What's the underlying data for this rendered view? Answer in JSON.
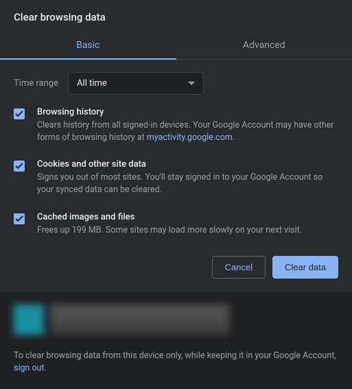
{
  "dialog": {
    "title": "Clear browsing data"
  },
  "tabs": {
    "basic": "Basic",
    "advanced": "Advanced"
  },
  "timeRange": {
    "label": "Time range",
    "value": "All time"
  },
  "options": {
    "history": {
      "title": "Browsing history",
      "desc_prefix": "Clears history from all signed-in devices. Your Google Account may have other forms of browsing history at ",
      "link": "myactivity.google.com",
      "desc_suffix": "."
    },
    "cookies": {
      "title": "Cookies and other site data",
      "desc": "Signs you out of most sites. You'll stay signed in to your Google Account so your synced data can be cleared."
    },
    "cache": {
      "title": "Cached images and files",
      "desc": "Frees up 199 MB. Some sites may load more slowly on your next visit."
    }
  },
  "buttons": {
    "cancel": "Cancel",
    "clear": "Clear data"
  },
  "footer": {
    "text_prefix": "To clear browsing data from this device only, while keeping it in your Google Account, ",
    "link": "sign out",
    "text_suffix": "."
  }
}
